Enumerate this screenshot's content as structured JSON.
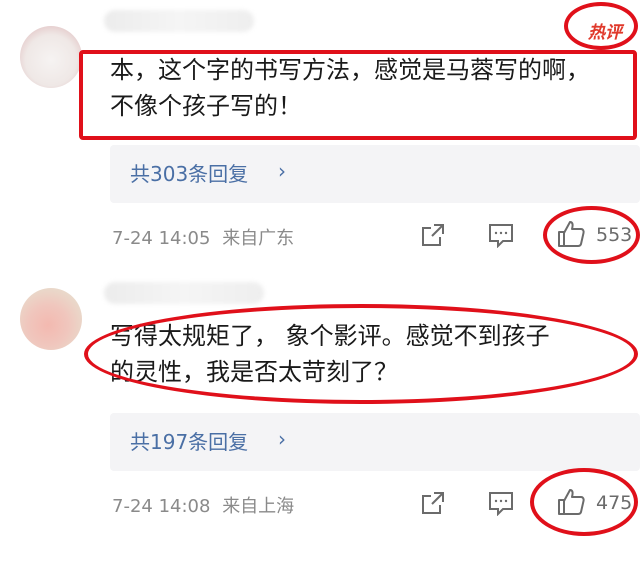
{
  "comments": [
    {
      "hot_badge": "热评",
      "text_line1": "本，这个字的书写方法，感觉是马蓉写的啊，",
      "text_line2": "不像个孩子写的！",
      "replies_label": "共303条回复",
      "reply_chevron": "›",
      "timestamp": "7-24 14:05",
      "location": "来自广东",
      "likes": "553"
    },
    {
      "text_line1": "写得太规矩了，  象个影评。感觉不到孩子",
      "text_line2": "的灵性，我是否太苛刻了？",
      "replies_label": "共197条回复",
      "reply_chevron": "›",
      "timestamp": "7-24 14:08",
      "location": "来自上海",
      "likes": "475"
    }
  ],
  "icons": {
    "share": "share-icon",
    "comment": "comment-icon",
    "like": "thumbs-up-icon"
  },
  "colors": {
    "annotation_red": "#e0101a",
    "link_blue": "#4a6fa5",
    "meta_gray": "#8a8a8a",
    "reply_bg": "#f4f4f6"
  }
}
